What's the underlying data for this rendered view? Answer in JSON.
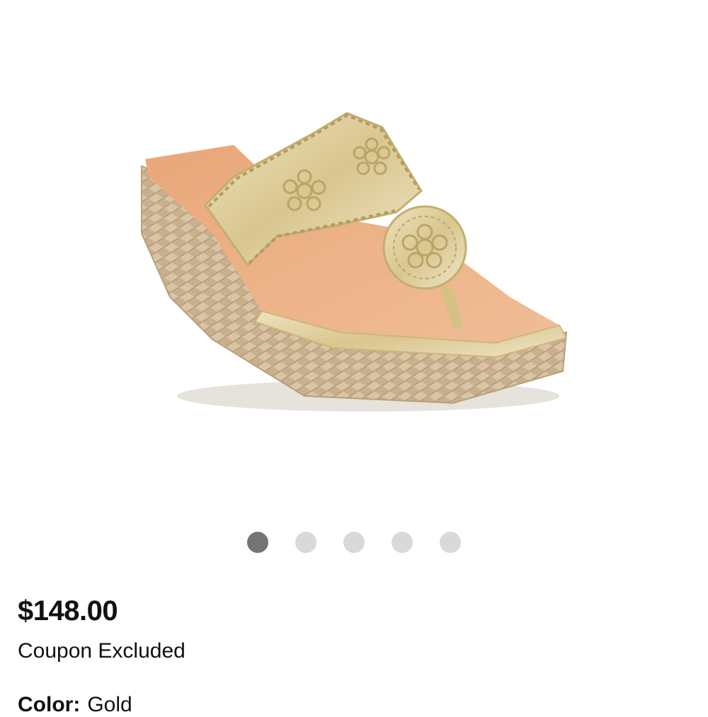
{
  "product": {
    "image_alt": "Gold metallic espadrille wedge thong sandal",
    "price": "$148.00",
    "coupon_note": "Coupon Excluded",
    "color_label": "Color:",
    "color_value": "Gold"
  },
  "carousel": {
    "total": 5,
    "active_index": 0
  },
  "colors": {
    "active_dot": "#757575",
    "inactive_dot": "#d9d9d9"
  }
}
